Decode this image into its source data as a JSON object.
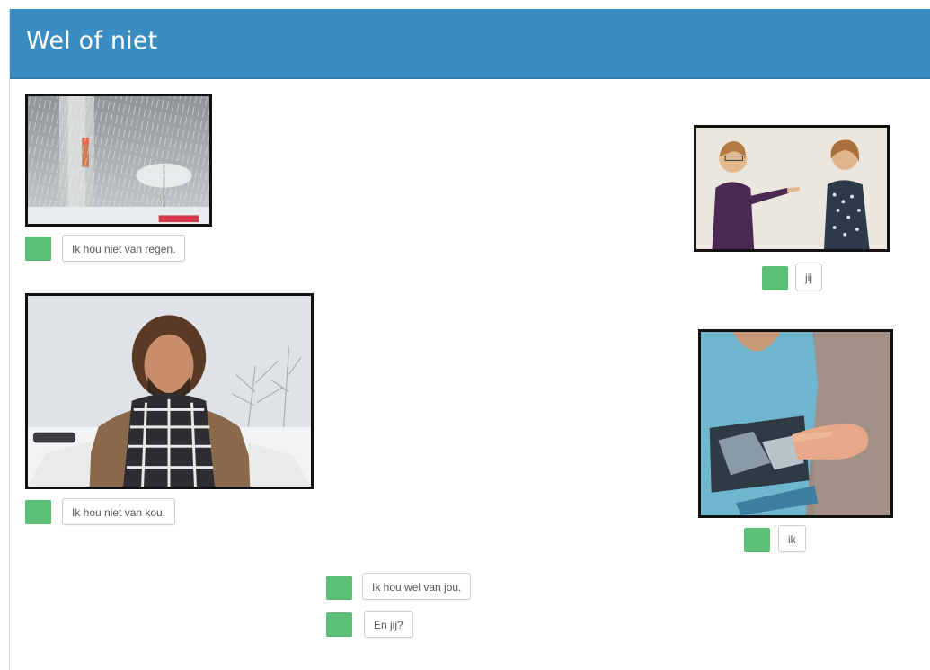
{
  "header": {
    "title": "Wel of niet"
  },
  "accent_color": "#3a8cc2",
  "play_button_color": "#5cbf78",
  "items": [
    {
      "label": "Ik hou niet van regen.",
      "image": "rain-umbrella-photo",
      "play_icon": "play-icon"
    },
    {
      "label": "jij",
      "image": "pointing-at-person-photo",
      "play_icon": "play-icon"
    },
    {
      "label": "Ik hou niet van kou.",
      "image": "man-in-snow-photo",
      "play_icon": "play-icon"
    },
    {
      "label": "ik",
      "image": "pointing-at-self-photo",
      "play_icon": "play-icon"
    },
    {
      "label": "Ik hou wel van jou.",
      "play_icon": "play-icon"
    },
    {
      "label": "En jij?",
      "play_icon": "play-icon"
    }
  ]
}
